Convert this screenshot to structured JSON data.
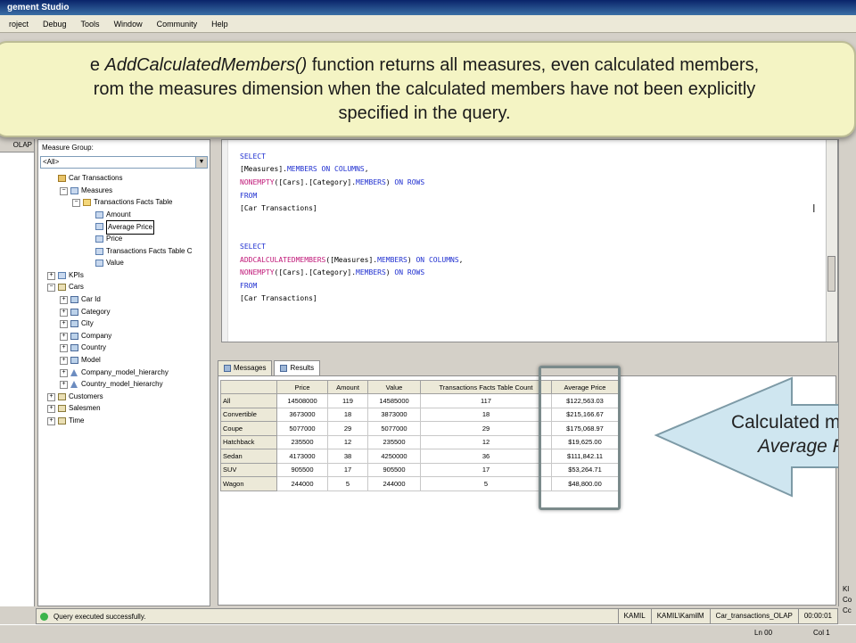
{
  "window": {
    "title": "gement Studio"
  },
  "menu": [
    "roject",
    "Debug",
    "Tools",
    "Window",
    "Community",
    "Help"
  ],
  "callout": {
    "line1_prefix": "e ",
    "line1_func": "AddCalculatedMembers()",
    "line1_suffix": " function returns all measures, even calculated members,",
    "line2": "rom the measures dimension when the calculated members have not been explicitly",
    "line3": "specified in the query."
  },
  "left_strip": {
    "header": "OLAP"
  },
  "metadata": {
    "label": "Measure Group:",
    "selected": "<All>",
    "tree": [
      {
        "label": "Car Transactions",
        "depth": 0,
        "icon": "cube-icon",
        "expander": ""
      },
      {
        "label": "Measures",
        "depth": 1,
        "icon": "measures-icon",
        "expander": "−"
      },
      {
        "label": "Transactions Facts Table",
        "depth": 2,
        "icon": "folder-icon",
        "expander": "−"
      },
      {
        "label": "Amount",
        "depth": 3,
        "icon": "measure-icon",
        "expander": ""
      },
      {
        "label": "Average Price",
        "depth": 3,
        "icon": "calculated-measure-icon",
        "expander": "",
        "selected": true
      },
      {
        "label": "Price",
        "depth": 3,
        "icon": "measure-icon",
        "expander": ""
      },
      {
        "label": "Transactions Facts Table C",
        "depth": 3,
        "icon": "measure-icon",
        "expander": ""
      },
      {
        "label": "Value",
        "depth": 3,
        "icon": "measure-icon",
        "expander": ""
      },
      {
        "label": "KPIs",
        "depth": 0,
        "icon": "kpi-icon",
        "expander": "+"
      },
      {
        "label": "Cars",
        "depth": 0,
        "icon": "dimension-icon",
        "expander": "−"
      },
      {
        "label": "Car Id",
        "depth": 1,
        "icon": "attribute-icon",
        "expander": "+"
      },
      {
        "label": "Category",
        "depth": 1,
        "icon": "attribute-icon",
        "expander": "+"
      },
      {
        "label": "City",
        "depth": 1,
        "icon": "attribute-icon",
        "expander": "+"
      },
      {
        "label": "Company",
        "depth": 1,
        "icon": "attribute-icon",
        "expander": "+"
      },
      {
        "label": "Country",
        "depth": 1,
        "icon": "attribute-icon",
        "expander": "+"
      },
      {
        "label": "Model",
        "depth": 1,
        "icon": "attribute-icon",
        "expander": "+"
      },
      {
        "label": "Company_model_hierarchy",
        "depth": 1,
        "icon": "hierarchy-icon",
        "expander": "+"
      },
      {
        "label": "Country_model_hierarchy",
        "depth": 1,
        "icon": "hierarchy-icon",
        "expander": "+"
      },
      {
        "label": "Customers",
        "depth": 0,
        "icon": "dimension-icon",
        "expander": "+"
      },
      {
        "label": "Salesmen",
        "depth": 0,
        "icon": "dimension-icon",
        "expander": "+"
      },
      {
        "label": "Time",
        "depth": 0,
        "icon": "dimension-icon",
        "expander": "+"
      }
    ]
  },
  "editor": {
    "query1": {
      "select": "SELECT",
      "l2a": "[Measures].",
      "l2b": "MEMBERS",
      "l2c": " ",
      "l2d": "ON",
      "l2e": " ",
      "l2f": "COLUMNS",
      "l2g": ",",
      "l3a": "NONEMPTY",
      "l3b": "([Cars].[Category].",
      "l3c": "MEMBERS",
      "l3d": ") ",
      "l3e": "ON",
      "l3f": " ",
      "l3g": "ROWS",
      "from": "FROM",
      "cube": "[Car Transactions]"
    },
    "query2": {
      "select": "SELECT",
      "l2a": "ADDCALCULATEDMEMBERS",
      "l2b": "([Measures].",
      "l2c": "MEMBERS",
      "l2d": ") ",
      "l2e": "ON",
      "l2f": " ",
      "l2g": "COLUMNS",
      "l2h": ",",
      "l3a": "NONEMPTY",
      "l3b": "([Cars].[Category].",
      "l3c": "MEMBERS",
      "l3d": ") ",
      "l3e": "ON",
      "l3f": " ",
      "l3g": "ROWS",
      "from": "FROM",
      "cube": "[Car Transactions]"
    }
  },
  "tabs": {
    "messages": "Messages",
    "results": "Results"
  },
  "results": {
    "columns": [
      "",
      "Price",
      "Amount",
      "Value",
      "Transactions Facts Table Count",
      "Average Price"
    ],
    "rows": [
      [
        "All",
        "14508000",
        "119",
        "14585000",
        "117",
        "$122,563.03"
      ],
      [
        "Convertible",
        "3673000",
        "18",
        "3873000",
        "18",
        "$215,166.67"
      ],
      [
        "Coupe",
        "5077000",
        "29",
        "5077000",
        "29",
        "$175,068.97"
      ],
      [
        "Hatchback",
        "235500",
        "12",
        "235500",
        "12",
        "$19,625.00"
      ],
      [
        "Sedan",
        "4173000",
        "38",
        "4250000",
        "36",
        "$111,842.11"
      ],
      [
        "SUV",
        "905500",
        "17",
        "905500",
        "17",
        "$53,264.71"
      ],
      [
        "Wagon",
        "244000",
        "5",
        "244000",
        "5",
        "$48,800.00"
      ]
    ]
  },
  "arrow_callout": {
    "line1": "Calculated m",
    "line2": "Average P"
  },
  "right_strip": {
    "l1": "Kl",
    "l2": "Co",
    "l3": "Cc"
  },
  "status": {
    "message": "Query executed successfully.",
    "server": "KAMIL",
    "user": "KAMIL\\KamilM",
    "database": "Car_transactions_OLAP",
    "time": "00:00:01"
  },
  "bottom": {
    "line": "Ln 00",
    "col": "Col 1"
  },
  "colors": {
    "accent": "#2030d0",
    "function": "#c01878",
    "callout_bg": "#f4f4c4"
  }
}
